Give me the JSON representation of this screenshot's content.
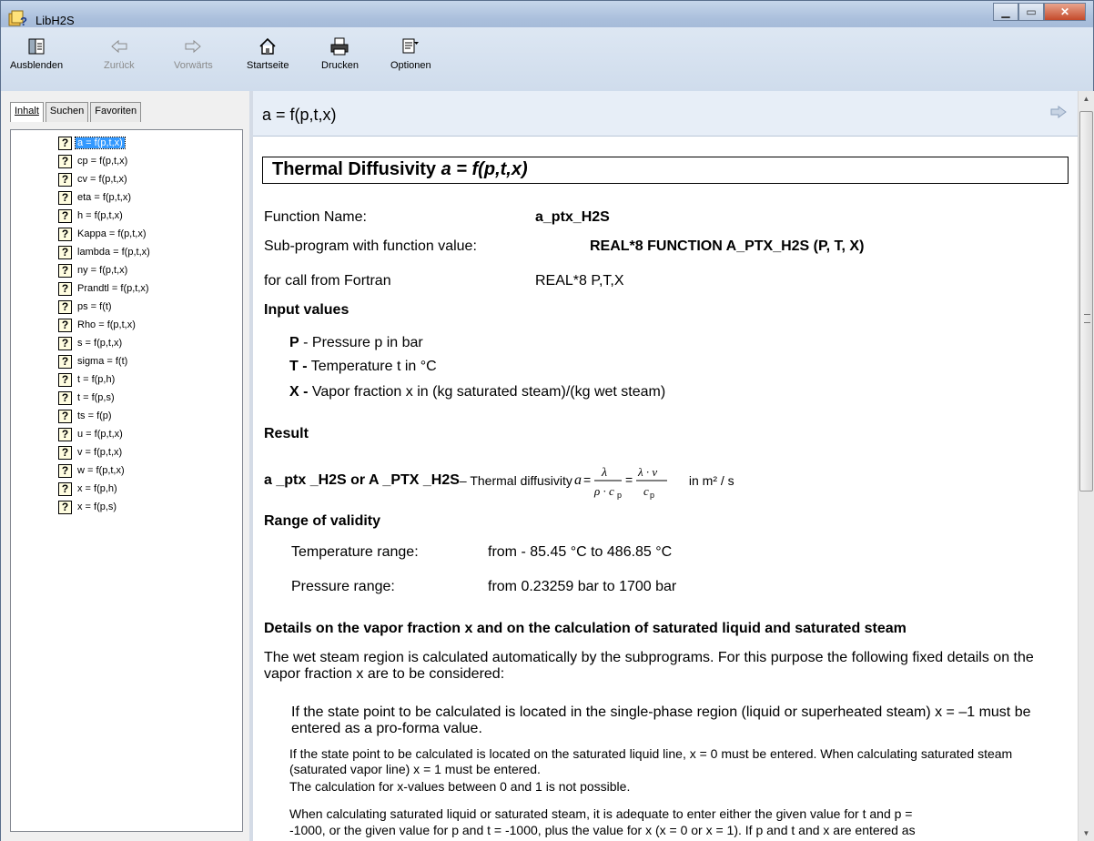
{
  "window": {
    "title": "LibH2S"
  },
  "toolbar": {
    "hide": "Ausblenden",
    "back": "Zurück",
    "forward": "Vorwärts",
    "home": "Startseite",
    "print": "Drucken",
    "options": "Optionen"
  },
  "tabs": {
    "contents": "Inhalt",
    "search": "Suchen",
    "favorites": "Favoriten"
  },
  "tree": [
    "a = f(p,t,x)",
    "cp = f(p,t,x)",
    "cv = f(p,t,x)",
    "eta = f(p,t,x)",
    "h = f(p,t,x)",
    "Kappa = f(p,t,x)",
    "lambda = f(p,t,x)",
    "ny = f(p,t,x)",
    "Prandtl = f(p,t,x)",
    "ps = f(t)",
    "Rho = f(p,t,x)",
    "s = f(p,t,x)",
    "sigma = f(t)",
    "t = f(p,h)",
    "t = f(p,s)",
    "ts = f(p)",
    "u = f(p,t,x)",
    "v = f(p,t,x)",
    "w = f(p,t,x)",
    "x = f(p,h)",
    "x = f(p,s)"
  ],
  "topic": {
    "title": "a = f(p,t,x)",
    "heading_text": "Thermal Diffusivity ",
    "heading_formula": "a = f(p,t,x)",
    "function_name_label": "Function Name:",
    "function_name_value": "a_ptx_H2S",
    "subprogram_label": "Sub-program with function value:",
    "subprogram_value": "REAL*8 FUNCTION A_PTX_H2S (P, T, X)",
    "fortran_label": "for call from Fortran",
    "fortran_value": "REAL*8 P,T,X",
    "input_heading": "Input values",
    "input_p_key": "P",
    "input_p_text": " - Pressure p in bar",
    "input_t_key": "T -",
    "input_t_text": " Temperature t in °C",
    "input_x_key": "X -",
    "input_x_text": " Vapor fraction x in (kg saturated steam)/(kg wet steam)",
    "result_heading": "Result",
    "result_names": "a _ptx _H2S  or  A _PTX _H2S",
    "result_text": " – Thermal diffusivity ",
    "result_units": " in m² / s",
    "validity_heading": "Range of validity",
    "temp_label": "Temperature range:",
    "temp_value": "from  - 85.45 °C  to  486.85 °C",
    "pressure_label": "Pressure range:",
    "pressure_value": "from   0.23259 bar  to  1700 bar",
    "details_heading": "Details on the vapor fraction x and on the calculation of saturated liquid and saturated steam",
    "details_p1": "The wet steam region is calculated automatically by the subprograms. For this purpose the following fixed details on the vapor fraction x are to be considered:",
    "details_p2": "If the state point to be calculated is located in the single-phase region (liquid or superheated steam) x = –1 must be entered as a pro-forma value.",
    "details_p3": "If the state point to be calculated is located on the saturated liquid line, x = 0 must be entered. When calculating saturated steam (saturated vapor line) x = 1 must be entered.",
    "details_p4": "The calculation for x-values between 0 and 1 is not possible.",
    "details_p5": "When calculating saturated liquid or saturated steam, it is adequate to enter either the given value for t and p =",
    "details_p5b": "-1000, or the given value for p and t = -1000, plus the value for x (x = 0 or x = 1). If p and t and x are entered as"
  }
}
